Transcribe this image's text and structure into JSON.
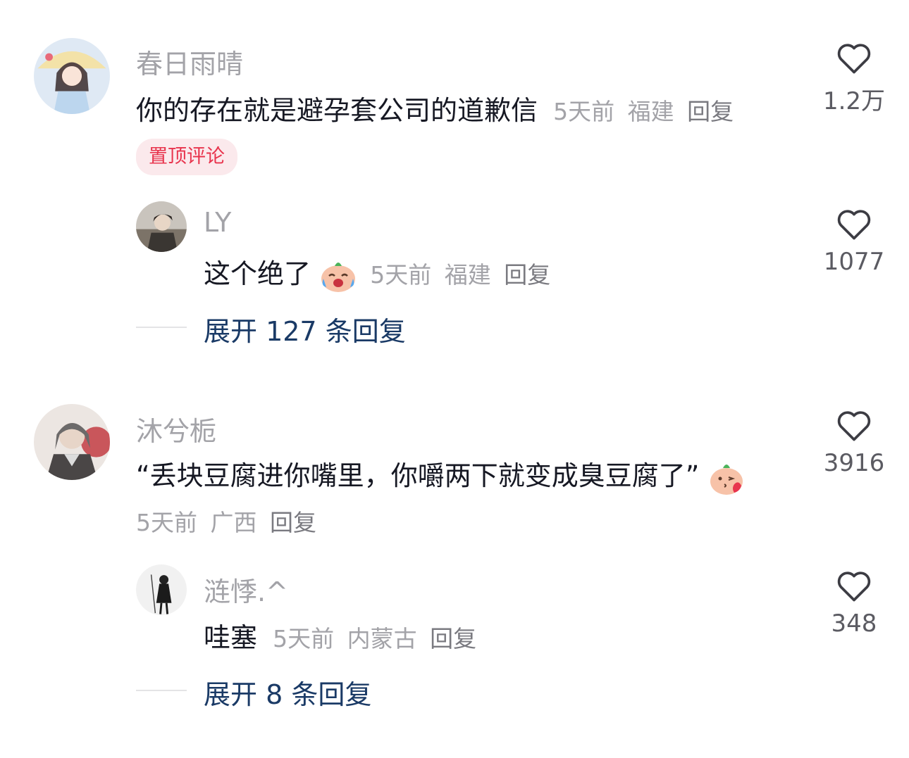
{
  "comments": [
    {
      "username": "春日雨晴",
      "text": "你的存在就是避孕套公司的道歉信",
      "time": "5天前",
      "location": "福建",
      "reply_label": "回复",
      "likes": "1.2万",
      "pinned_label": "置顶评论",
      "replies": [
        {
          "username": "LY",
          "text": "这个绝了",
          "emoji": "crying-laughing-peach-emoji",
          "time": "5天前",
          "location": "福建",
          "reply_label": "回复",
          "likes": "1077"
        }
      ],
      "expand_label": "展开 127 条回复"
    },
    {
      "username": "沐兮栀",
      "text": "“丢块豆腐进你嘴里，你嚼两下就变成臭豆腐了”",
      "emoji": "kiss-peach-emoji",
      "time": "5天前",
      "location": "广西",
      "reply_label": "回复",
      "likes": "3916",
      "replies": [
        {
          "username": "涟悸.^",
          "text": "哇塞",
          "time": "5天前",
          "location": "内蒙古",
          "reply_label": "回复",
          "likes": "348"
        }
      ],
      "expand_label": "展开 8 条回复"
    }
  ],
  "icons": {
    "like": "heart-outline-icon"
  },
  "colors": {
    "pinned_badge_bg": "#fbe9ec",
    "pinned_badge_text": "#e8344d",
    "expand_link": "#1a3a66",
    "meta_text": "#a3a3a8"
  }
}
